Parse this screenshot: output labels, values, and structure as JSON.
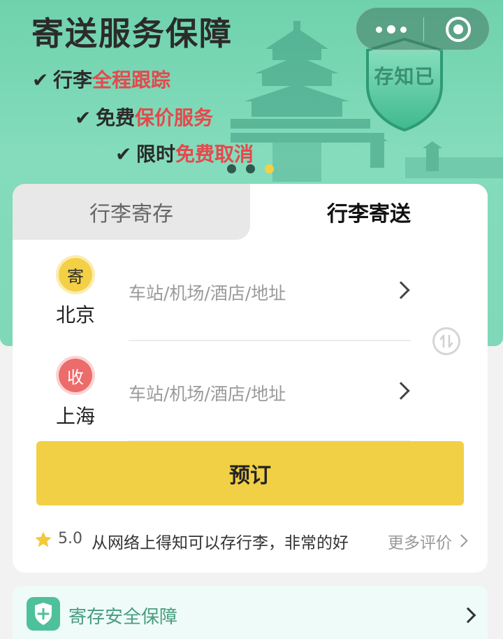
{
  "banner": {
    "headline": "寄送服务保障",
    "bullets": [
      {
        "check": "✔",
        "prefix": "行李",
        "highlight": "全程跟踪"
      },
      {
        "check": "✔",
        "prefix": "免费",
        "highlight": "保价服务"
      },
      {
        "check": "✔",
        "prefix": "限时",
        "highlight": "免费取消"
      }
    ],
    "shield_text": "存知已",
    "carousel_active_index": 2,
    "carousel_count": 3
  },
  "colors": {
    "banner_green": "#7fd8b7",
    "accent_yellow": "#f1d045",
    "highlight_red": "#e5484d",
    "receive_red": "#ec6b6b",
    "safety_green": "#4ec09a"
  },
  "tabs": [
    {
      "label": "行李寄存",
      "active": false
    },
    {
      "label": "行李寄送",
      "active": true
    }
  ],
  "route": {
    "from": {
      "badge": "寄",
      "city": "北京",
      "placeholder": "车站/机场/酒店/地址"
    },
    "to": {
      "badge": "收",
      "city": "上海",
      "placeholder": "车站/机场/酒店/地址"
    }
  },
  "book_button": "预订",
  "review": {
    "score": "5.0",
    "text": "从网络上得知可以存行李，非常的好",
    "more": "更多评价"
  },
  "safety": {
    "label": "寄存安全保障"
  }
}
